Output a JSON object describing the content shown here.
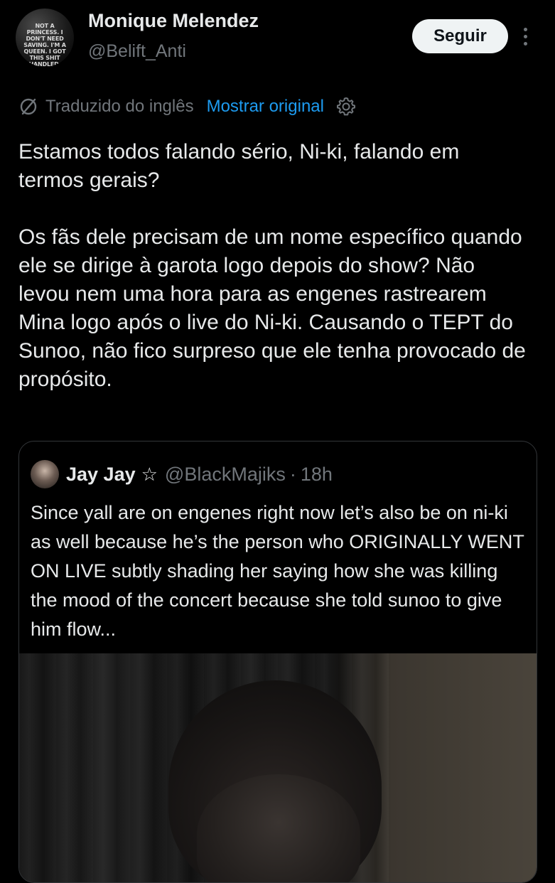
{
  "author": {
    "display_name": "Monique Melendez",
    "handle": "@Belift_Anti",
    "avatar_text": "NOT A PRINCESS. I DON'T NEED SAVING. I'M A QUEEN. I GOT THIS SHIT HANDLED."
  },
  "actions": {
    "follow_label": "Seguir",
    "more_icon": "more-dots-icon"
  },
  "translation": {
    "label": "Traduzido do inglês",
    "show_original": "Mostrar original",
    "icon": "translate-icon",
    "settings_icon": "gear-icon"
  },
  "tweet": {
    "paragraph_1": "Estamos todos falando sério, Ni-ki, falando em termos gerais?",
    "paragraph_2": "Os fãs dele precisam de um nome específico quando ele se dirige à garota logo depois do show? Não levou nem uma hora para as engenes rastrearem Mina logo após o live do Ni-ki. Causando o TEPT do Sunoo, não fico surpreso que ele tenha provocado de propósito."
  },
  "quote": {
    "display_name": "Jay Jay",
    "name_symbol": "☆",
    "handle": "@BlackMajiks",
    "separator": "·",
    "time": "18h",
    "text": "Since yall are on  engenes right now let’s also be on ni-ki as well because he’s the person who ORIGINALLY WENT ON LIVE subtly shading her saying how she was killing the mood of the concert because she told sunoo to give him flow..."
  },
  "colors": {
    "background": "#000000",
    "text_primary": "#e7e9ea",
    "text_secondary": "#71767b",
    "accent": "#1d9bf0",
    "follow_button_bg": "#eff3f4",
    "border": "#333639"
  }
}
